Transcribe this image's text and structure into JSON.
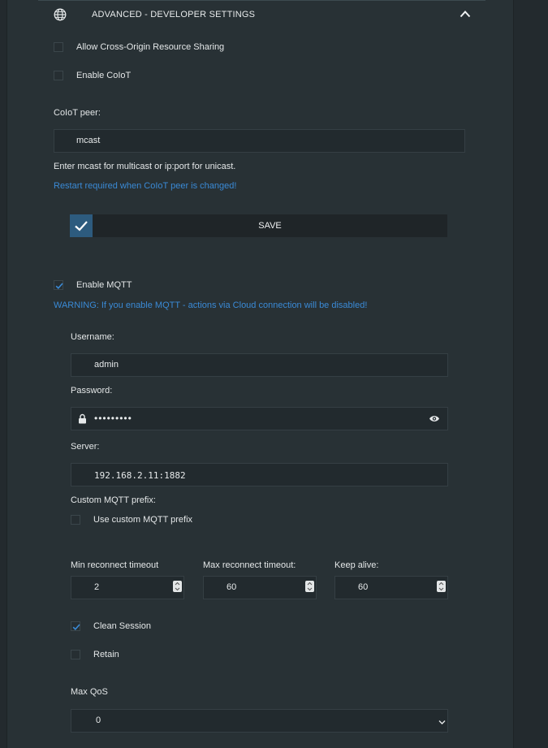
{
  "section": {
    "title": "ADVANCED - DEVELOPER SETTINGS",
    "icon": "globe-icon",
    "collapse_icon": "chevron-up-icon"
  },
  "cors": {
    "label": "Allow Cross-Origin Resource Sharing",
    "checked": false
  },
  "coiot": {
    "label": "Enable CoIoT",
    "checked": false
  },
  "coiot_peer": {
    "label": "CoIoT peer:",
    "value": "mcast",
    "hint": "Enter mcast for multicast or ip:port for unicast.",
    "restart_note": "Restart required when CoIoT peer is changed!"
  },
  "save": {
    "label": "SAVE",
    "icon": "check-icon"
  },
  "mqtt": {
    "enable_label": "Enable MQTT",
    "enabled": true,
    "warning": "WARNING: If you enable MQTT - actions via Cloud connection will be disabled!",
    "username": {
      "label": "Username:",
      "value": "admin"
    },
    "password": {
      "label": "Password:",
      "value": "•••••••••",
      "lock_icon": "lock-icon",
      "reveal_icon": "eye-icon"
    },
    "server": {
      "label": "Server:",
      "value": "192.168.2.11:1882"
    },
    "custom_prefix": {
      "label": "Custom MQTT prefix:",
      "checkbox_label": "Use custom MQTT prefix",
      "checked": false
    },
    "min_reconnect": {
      "label": "Min reconnect timeout",
      "value": "2"
    },
    "max_reconnect": {
      "label": "Max reconnect timeout:",
      "value": "60"
    },
    "keep_alive": {
      "label": "Keep alive:",
      "value": "60"
    },
    "clean_session": {
      "label": "Clean Session",
      "checked": true
    },
    "retain": {
      "label": "Retain",
      "checked": false
    },
    "max_qos": {
      "label": "Max QoS",
      "value": "0",
      "icon": "chevron-down-icon"
    }
  },
  "colors": {
    "accent": "#3a8ad6",
    "save_check_bg": "#2d5b7e",
    "panel_bg": "#283135",
    "page_bg": "#232a2e"
  }
}
